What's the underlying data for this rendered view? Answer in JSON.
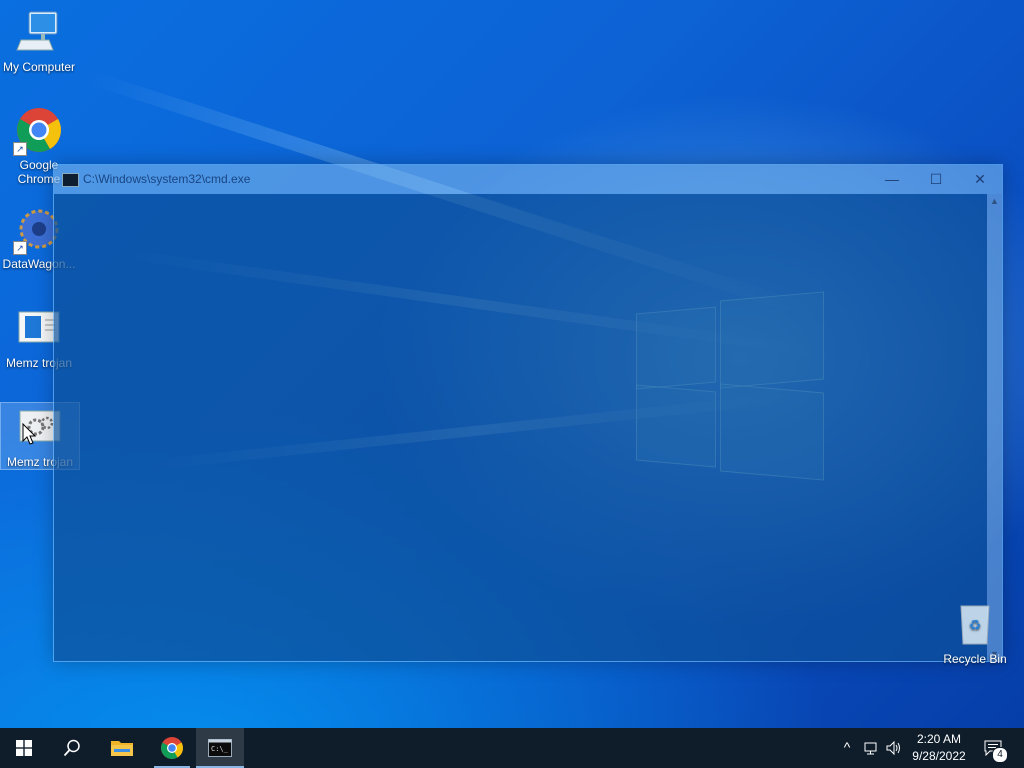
{
  "desktop": {
    "icons": [
      {
        "label": "My Computer"
      },
      {
        "label": "Google Chrome"
      },
      {
        "label": "DataWagon..."
      },
      {
        "label": "Memz trojan"
      },
      {
        "label": "Memz trojan"
      }
    ],
    "recycle_bin": {
      "label": "Recycle Bin"
    }
  },
  "cmd_window": {
    "title": "C:\\Windows\\system32\\cmd.exe",
    "minimize_glyph": "—",
    "maximize_glyph": "☐",
    "close_glyph": "✕"
  },
  "taskbar": {
    "pinned": [
      {
        "name": "start-button"
      },
      {
        "name": "search-button"
      },
      {
        "name": "file-explorer"
      },
      {
        "name": "google-chrome"
      },
      {
        "name": "command-prompt"
      }
    ],
    "clock_time": "2:20 AM",
    "clock_date": "9/28/2022",
    "notification_count": "4",
    "tray_chevron": "^"
  },
  "colors": {
    "taskbar": "#0f1d2b",
    "wallpaper": "#0a5fd0"
  }
}
